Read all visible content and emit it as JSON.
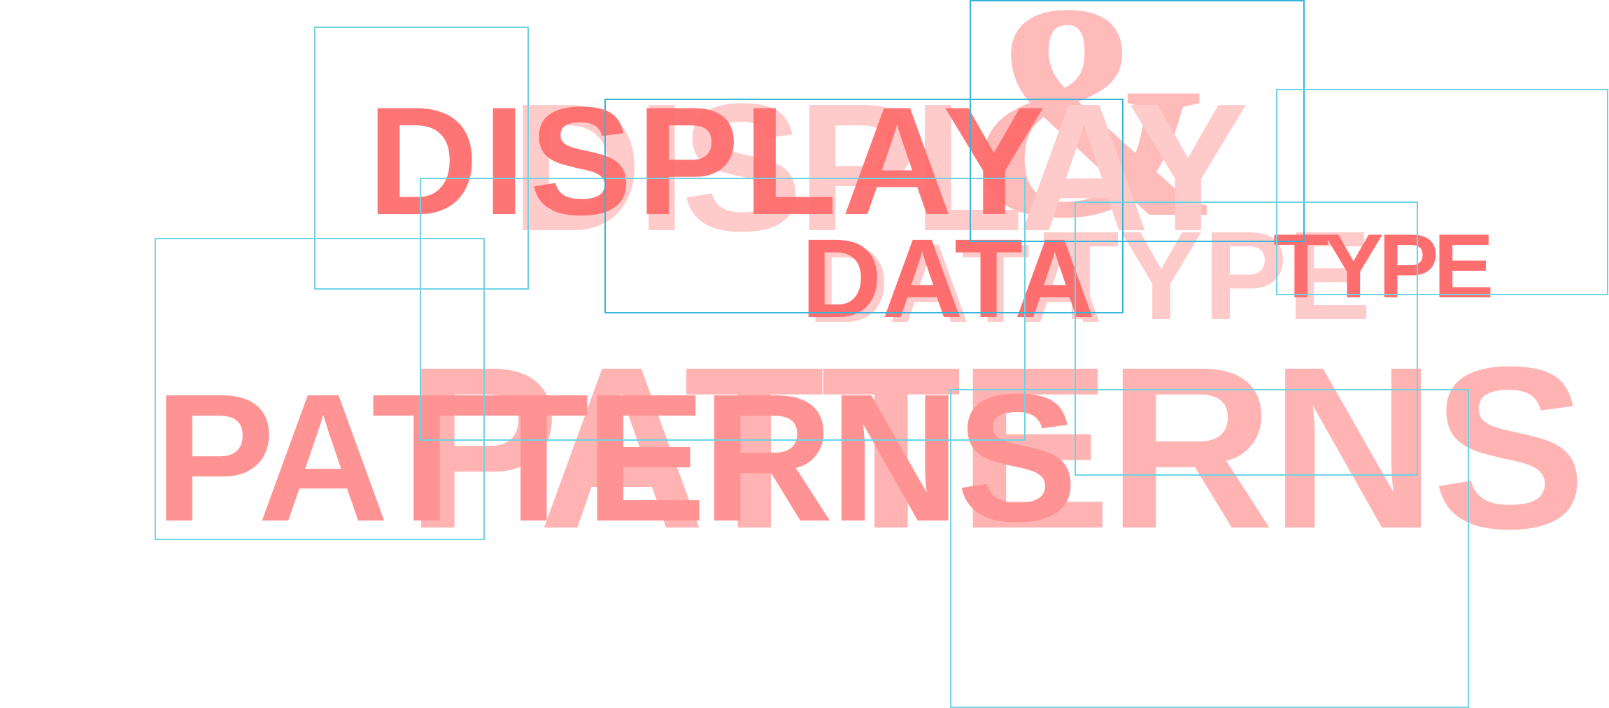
{
  "composition": {
    "word_display": "DISPLAY",
    "word_data": "DATA",
    "word_type": "TYPE",
    "word_patterns": "PATTERNS",
    "ampersand": "&"
  },
  "colors": {
    "red_strong": "#ff4d4d",
    "red_mid": "#ff6e6e",
    "red_light": "#ffb3b3",
    "red_pale": "#ffe8e8",
    "frame_cyan": "#6fd3e4",
    "frame_cyan_dark": "#35b6d8",
    "background": "#ffffff"
  }
}
